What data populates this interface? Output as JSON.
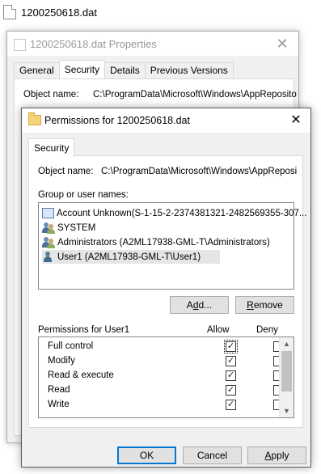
{
  "file_name": "1200250618.dat",
  "bg_window": {
    "title": "1200250618.dat Properties",
    "close_glyph": "✕",
    "tabs": [
      "General",
      "Security",
      "Details",
      "Previous Versions"
    ],
    "active_tab": "Security",
    "object_name_label": "Object name:",
    "object_name_value": "C:\\ProgramData\\Microsoft\\Windows\\AppReposito"
  },
  "dialog": {
    "title": "Permissions for 1200250618.dat",
    "close_glyph": "✕",
    "tab": "Security",
    "object_name_label": "Object name:",
    "object_name_value": "C:\\ProgramData\\Microsoft\\Windows\\AppReposito",
    "group_label": "Group or user names:",
    "users": [
      {
        "name": "Account Unknown(S-1-15-2-2374381321-2482569355-307...",
        "icon": "unknown-account-icon",
        "selected": false
      },
      {
        "name": "SYSTEM",
        "icon": "users-group-icon",
        "selected": false
      },
      {
        "name": "Administrators (A2ML17938-GML-T\\Administrators)",
        "icon": "users-group-icon",
        "selected": false
      },
      {
        "name": "User1 (A2ML17938-GML-T\\User1)",
        "icon": "user-icon",
        "selected": true
      }
    ],
    "add_button": {
      "pre": "A",
      "accel": "d",
      "post": "d..."
    },
    "remove_button": {
      "accel": "R",
      "post": "emove"
    },
    "permissions_label": "Permissions for User1",
    "allow_header": "Allow",
    "deny_header": "Deny",
    "permissions": [
      {
        "name": "Full control",
        "allow": true,
        "deny": false
      },
      {
        "name": "Modify",
        "allow": true,
        "deny": false
      },
      {
        "name": "Read & execute",
        "allow": true,
        "deny": false
      },
      {
        "name": "Read",
        "allow": true,
        "deny": false
      },
      {
        "name": "Write",
        "allow": true,
        "deny": false
      }
    ],
    "ok_label": "OK",
    "cancel_label": "Cancel",
    "apply_button": {
      "accel": "A",
      "post": "pply"
    },
    "check_glyph": "✓"
  },
  "colors": {
    "dialog_bg": "#f0f0f0",
    "focus_border": "#0078d7",
    "selected_row": "#e5e5e5"
  }
}
